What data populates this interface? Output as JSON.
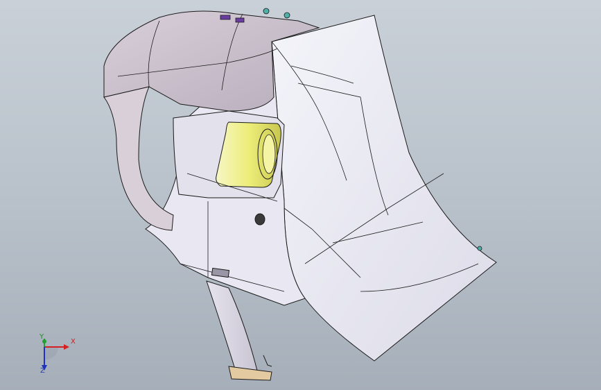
{
  "view": {
    "background_top": "#c9d0d8",
    "background_bottom": "#a6afb9",
    "part_color": "#ecebf4",
    "part_shade": "#c7bcc8",
    "edge_color": "#1a1a1a",
    "highlight_color": "#f2f27a",
    "fastener_color": "#6a3ea0",
    "clip_color": "#4fb0a8"
  },
  "triad": {
    "x_label": "X",
    "y_label": "Y",
    "z_label": "Z",
    "x_color": "#d42020",
    "y_color": "#20a030",
    "z_color": "#2030c0"
  }
}
